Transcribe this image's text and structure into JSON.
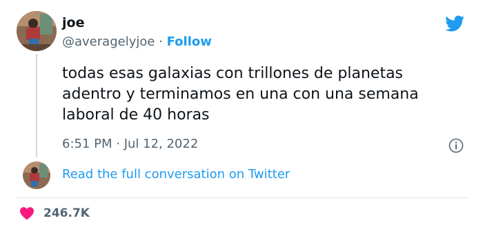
{
  "author": {
    "name": "joe",
    "handle": "@averagelyjoe",
    "separator": " · ",
    "follow_label": "Follow"
  },
  "tweet": {
    "lines": [
      "todas esas galaxias con trillones de planetas",
      "adentro y terminamos en una con una semana",
      "laboral de 40 horas"
    ],
    "timestamp": "6:51 PM · Jul 12, 2022"
  },
  "thread": {
    "read_label": "Read the full conversation on Twitter"
  },
  "engagement": {
    "likes": "246.7K"
  },
  "colors": {
    "twitter_blue": "#1d9bf0",
    "heart_red": "#f91880",
    "muted_text": "#536471"
  },
  "icons": [
    "twitter-bird-icon",
    "info-icon",
    "heart-icon"
  ]
}
